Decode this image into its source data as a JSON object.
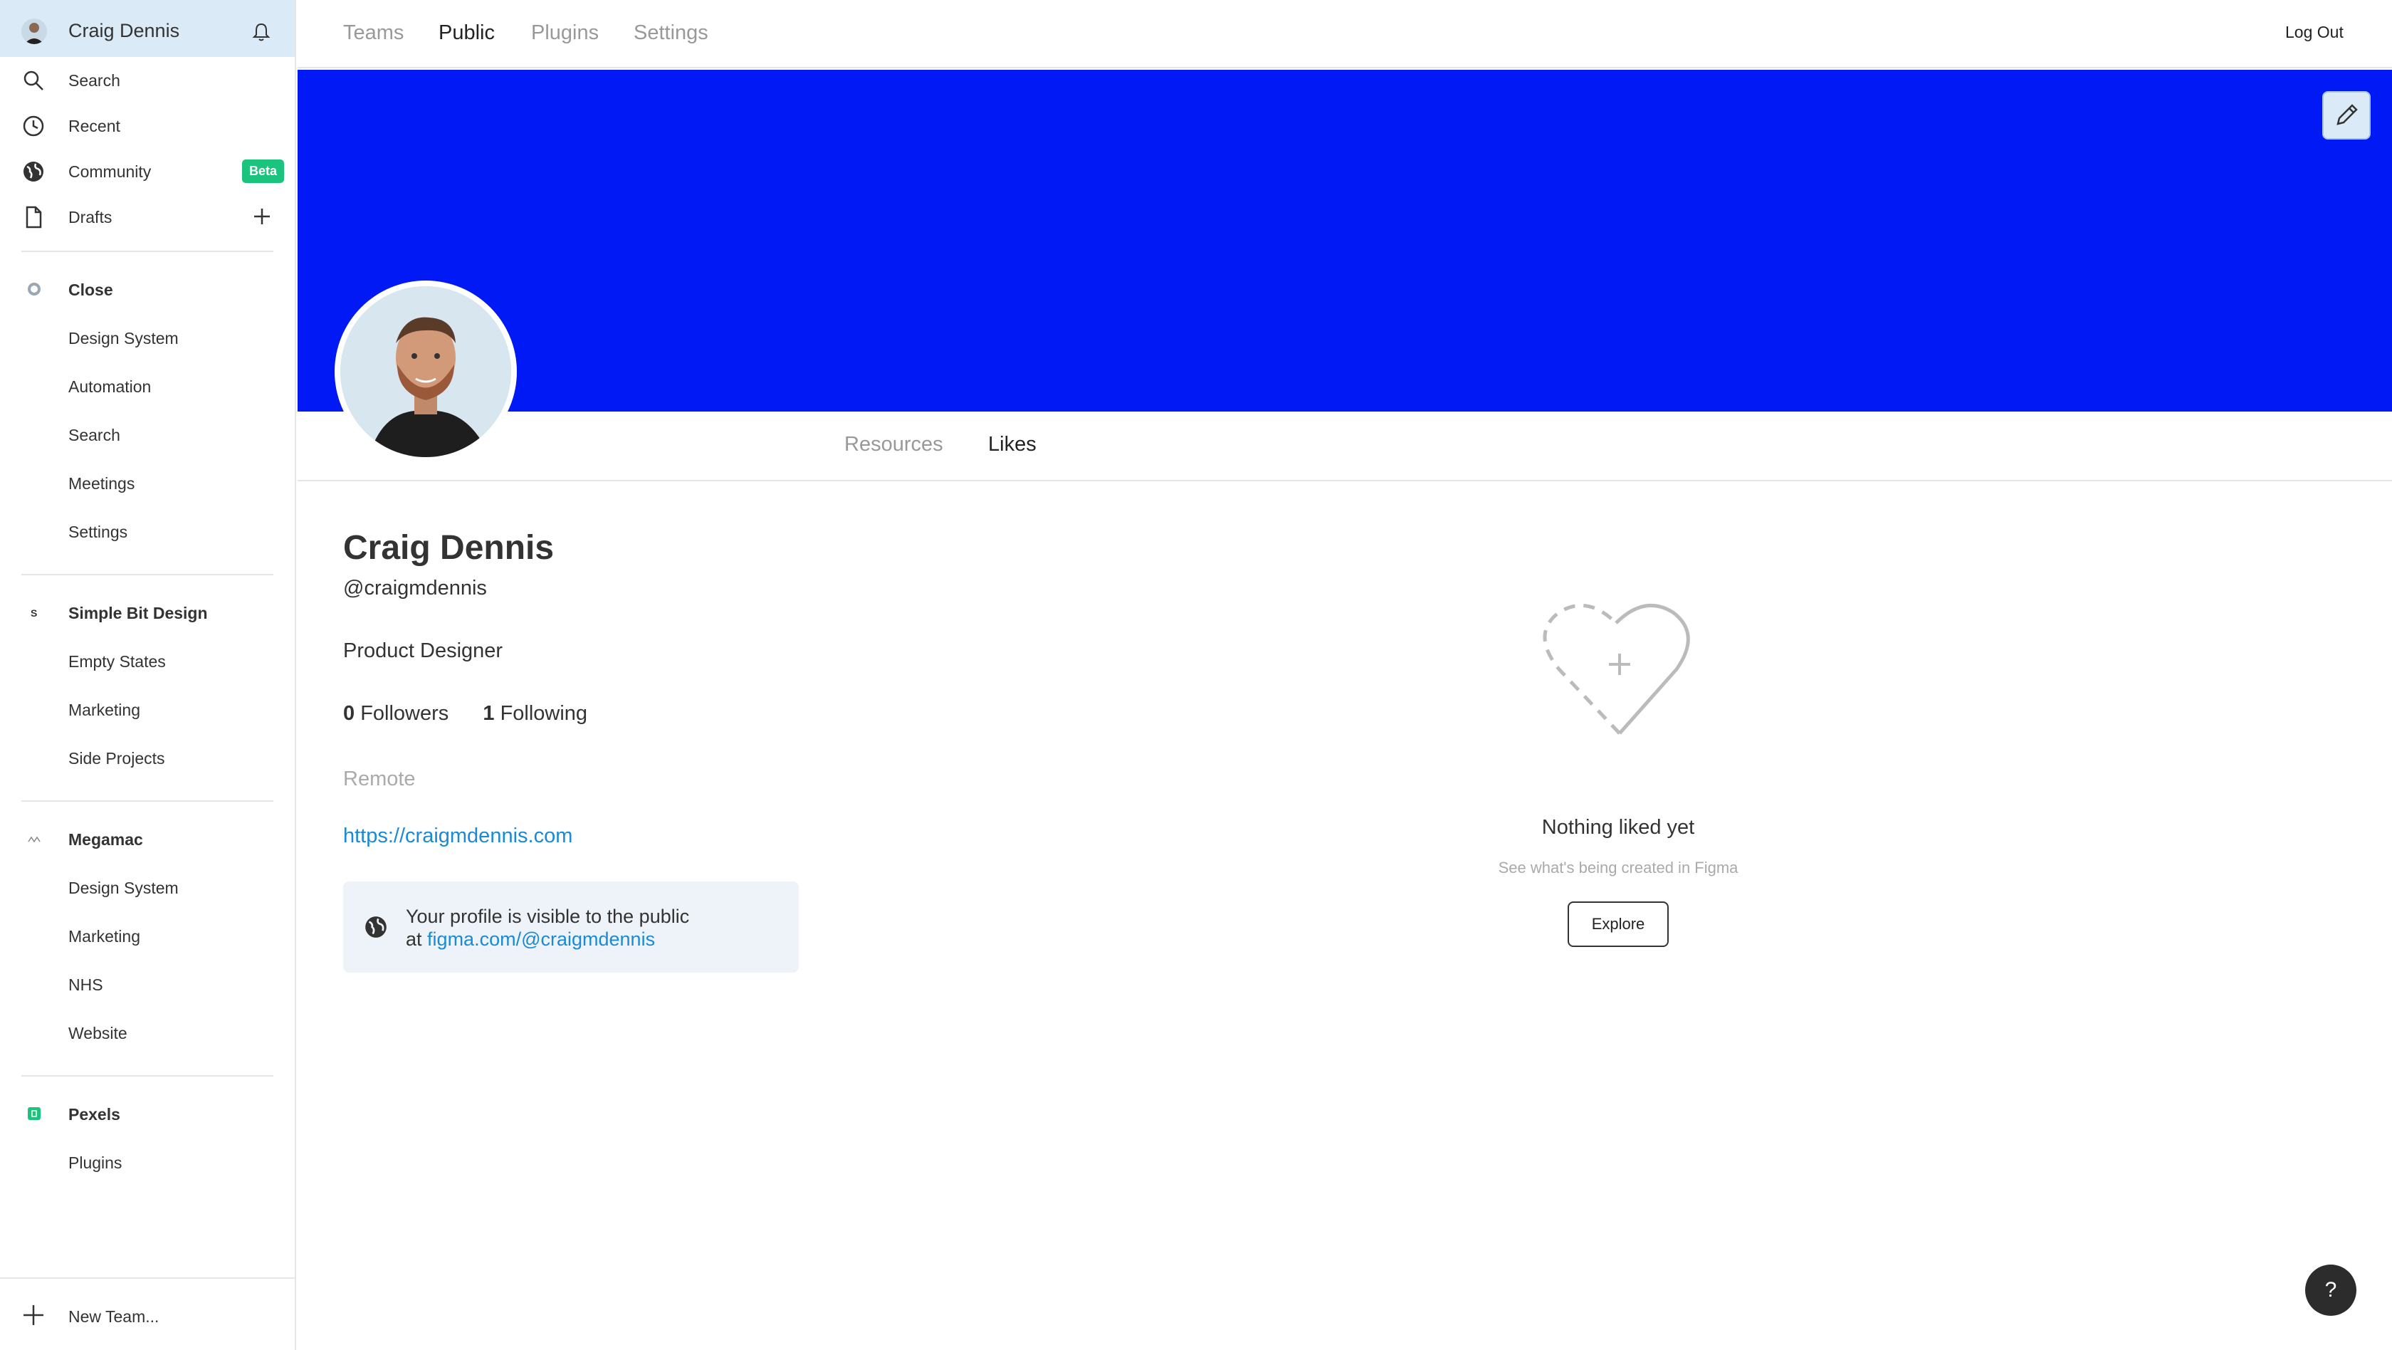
{
  "sidebar": {
    "user_name": "Craig Dennis",
    "nav": [
      {
        "label": "Search",
        "icon": "search-icon"
      },
      {
        "label": "Recent",
        "icon": "clock-icon"
      },
      {
        "label": "Community",
        "icon": "globe-icon",
        "badge": "Beta"
      },
      {
        "label": "Drafts",
        "icon": "file-icon"
      }
    ],
    "teams": [
      {
        "name": "Close",
        "color": "#9aa7b4",
        "projects": [
          "Design System",
          "Automation",
          "Search",
          "Meetings",
          "Settings"
        ]
      },
      {
        "name": "Simple Bit Design",
        "color": "#333333",
        "projects": [
          "Empty States",
          "Marketing",
          "Side Projects"
        ]
      },
      {
        "name": "Megamac",
        "color": "#888888",
        "projects": [
          "Design System",
          "Marketing",
          "NHS",
          "Website"
        ]
      },
      {
        "name": "Pexels",
        "color": "#1bc47d",
        "projects": [
          "Plugins"
        ]
      }
    ],
    "new_team_label": "New Team..."
  },
  "topbar": {
    "tabs": [
      "Teams",
      "Public",
      "Plugins",
      "Settings"
    ],
    "active_tab": "Public",
    "logout_label": "Log Out"
  },
  "banner": {
    "color": "#0019f5"
  },
  "profile_tabs": {
    "items": [
      "Resources",
      "Likes"
    ],
    "active": "Likes"
  },
  "profile": {
    "name": "Craig Dennis",
    "handle": "@craigmdennis",
    "role": "Product Designer",
    "followers_count": "0",
    "followers_label": "Followers",
    "following_count": "1",
    "following_label": "Following",
    "location": "Remote",
    "website": "https://craigmdennis.com",
    "visibility_line1": "Your profile is visible to the public",
    "visibility_prefix": "at",
    "visibility_link": "figma.com/@craigmdennis"
  },
  "empty_state": {
    "title": "Nothing liked yet",
    "subtitle": "See what's being created in Figma",
    "button_label": "Explore"
  },
  "help_label": "?"
}
